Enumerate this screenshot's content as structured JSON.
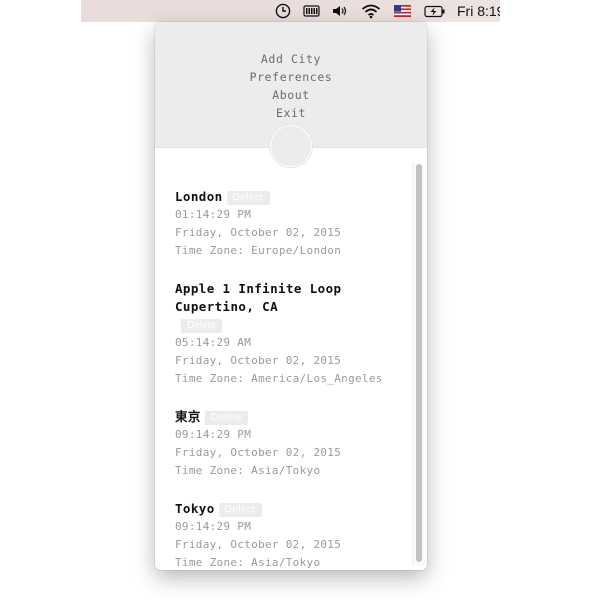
{
  "menubar": {
    "clock_text": "Fri 8:19",
    "icons": [
      "clock-icon",
      "battery-meter-icon",
      "volume-icon",
      "wifi-icon",
      "us-flag-icon",
      "battery-charging-icon"
    ]
  },
  "menu": {
    "items": [
      "Add City",
      "Preferences",
      "About",
      "Exit"
    ]
  },
  "delete_label": "Delete",
  "cities": [
    {
      "name": "London",
      "time": "01:14:29 PM",
      "date": "Friday, October 02, 2015",
      "timezone": "Time Zone: Europe/London"
    },
    {
      "name_line1": "Apple 1 Infinite Loop",
      "name_line2": "Cupertino, CA",
      "time": "05:14:29 AM",
      "date": "Friday, October 02, 2015",
      "timezone": "Time Zone: America/Los_Angeles"
    },
    {
      "name": "東京",
      "time": "09:14:29 PM",
      "date": "Friday, October 02, 2015",
      "timezone": "Time Zone: Asia/Tokyo"
    },
    {
      "name": "Tokyo",
      "time": "09:14:29 PM",
      "date": "Friday, October 02, 2015",
      "timezone": "Time Zone: Asia/Tokyo"
    }
  ],
  "colors": {
    "header_bg": "#ececec",
    "primary_text": "#111111",
    "secondary_text": "#9a9a9a",
    "menu_text": "#6b6b6b",
    "delete_bg": "#ececec"
  }
}
